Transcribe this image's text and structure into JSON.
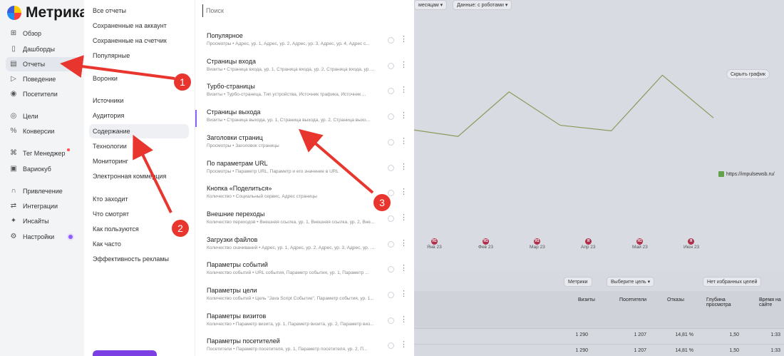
{
  "app": {
    "logo_text": "Метрика"
  },
  "leftnav": {
    "items": [
      {
        "label": "Обзор",
        "icon": "grid-icon"
      },
      {
        "label": "Дашборды",
        "icon": "dashboard-icon"
      },
      {
        "label": "Отчеты",
        "icon": "reports-icon",
        "active": true
      },
      {
        "label": "Поведение",
        "icon": "play-icon"
      },
      {
        "label": "Посетители",
        "icon": "user-icon"
      },
      {
        "label": "Цели",
        "icon": "target-icon"
      },
      {
        "label": "Конверсии",
        "icon": "percent-icon"
      },
      {
        "label": "Тег Менеджер",
        "icon": "tag-icon"
      },
      {
        "label": "Вариокуб",
        "icon": "cube-icon"
      },
      {
        "label": "Привлечение",
        "icon": "magnet-icon"
      },
      {
        "label": "Интеграции",
        "icon": "integrations-icon"
      },
      {
        "label": "Инсайты",
        "icon": "insights-icon"
      },
      {
        "label": "Настройки",
        "icon": "gear-icon"
      }
    ]
  },
  "menu": {
    "items": [
      "Все отчеты",
      "Сохраненные на аккаунт",
      "Сохраненные на счетчик",
      "Популярные",
      "Воронки",
      "Источники",
      "Аудитория",
      "Содержание",
      "Технологии",
      "Мониторинг",
      "Электронная коммерция",
      "Кто заходит",
      "Что смотрят",
      "Как пользуются",
      "Как часто",
      "Эффективность рекламы"
    ],
    "active_index": 7
  },
  "search": {
    "placeholder": "Поиск"
  },
  "reports": [
    {
      "title": "Популярное",
      "subtitle": "Просмотры • Адрес, ур. 1, Адрес, ур. 2, Адрес, ур. 3, Адрес, ур. 4, Адрес с..."
    },
    {
      "title": "Страницы входа",
      "subtitle": "Визиты • Страница входа, ур. 1, Страница входа, ур. 2, Страница входа, ур. 3, Стр..."
    },
    {
      "title": "Турбо-страницы",
      "subtitle": "Визиты • Турбо-страница, Тип устройства, Источник трафика, Источник ..."
    },
    {
      "title": "Страницы выхода",
      "subtitle": "Визиты • Страница выхода, ур. 1, Страница выхода, ур. 2, Страница выхо...",
      "active": true
    },
    {
      "title": "Заголовки страниц",
      "subtitle": "Просмотры • Заголовок страницы"
    },
    {
      "title": "По параметрам URL",
      "subtitle": "Просмотры • Параметр URL, Параметр и его значение в URL"
    },
    {
      "title": "Кнопка «Поделиться»",
      "subtitle": "Количество • Социальный сервис, Адрес страницы"
    },
    {
      "title": "Внешние переходы",
      "subtitle": "Количество переходов • Внешняя ссылка, ур. 1, Внешняя ссылка, ур. 2, Вне..."
    },
    {
      "title": "Загрузки файлов",
      "subtitle": "Количество скачиваний • Адрес, ур. 1, Адрес, ур. 2, Адрес, ур. 3, Адрес, ур. 4..."
    },
    {
      "title": "Параметры событий",
      "subtitle": "Количество событий • URL события, Параметр события, ур. 1, Параметр ..."
    },
    {
      "title": "Параметры цели",
      "subtitle": "Количество событий • Цель \"Java Script Событие\", Параметр события, ур. 1..."
    },
    {
      "title": "Параметры визитов",
      "subtitle": "Количество • Параметр визита, ур. 1, Параметр визита, ур. 2, Параметр виз..."
    },
    {
      "title": "Параметры посетителей",
      "subtitle": "Посетители • Параметр посетителя, ур. 1, Параметр посетителя, ур. 2, П..."
    }
  ],
  "background": {
    "pill_period": "месяцам",
    "pill_data": "Данные: с роботами",
    "hide_chart": "Скрыть график",
    "legend": "https://impulsewsb.ru/",
    "x_labels": [
      "Янв 23",
      "Фев 23",
      "Мар 23",
      "Апр 23",
      "Май 23",
      "Июн 23"
    ],
    "markers": [
      "Я1",
      "Я1",
      "Я1",
      "Я",
      "Я1",
      "Я"
    ],
    "chart_values": [
      0.42,
      0.38,
      0.62,
      0.44,
      0.41,
      0.71,
      0.48
    ],
    "metrics_btn": "Метрики",
    "goal_btn": "Выберите цель",
    "fav_btn": "Нет избранных целей",
    "columns": [
      "Визиты",
      "Посетители",
      "Отказы",
      "Глубина просмотра",
      "Время на сайте"
    ],
    "rows": [
      [
        "1 290",
        "1 207",
        "14,81 %",
        "1,50",
        "1:33"
      ],
      [
        "1 290",
        "1 207",
        "14,81 %",
        "1,50",
        "1:33"
      ]
    ]
  },
  "annotations": [
    "1",
    "2",
    "3"
  ],
  "colors": {
    "accent": "#8c5cff",
    "arrow": "#e8362f",
    "chart_line": "#8a9a5b"
  }
}
